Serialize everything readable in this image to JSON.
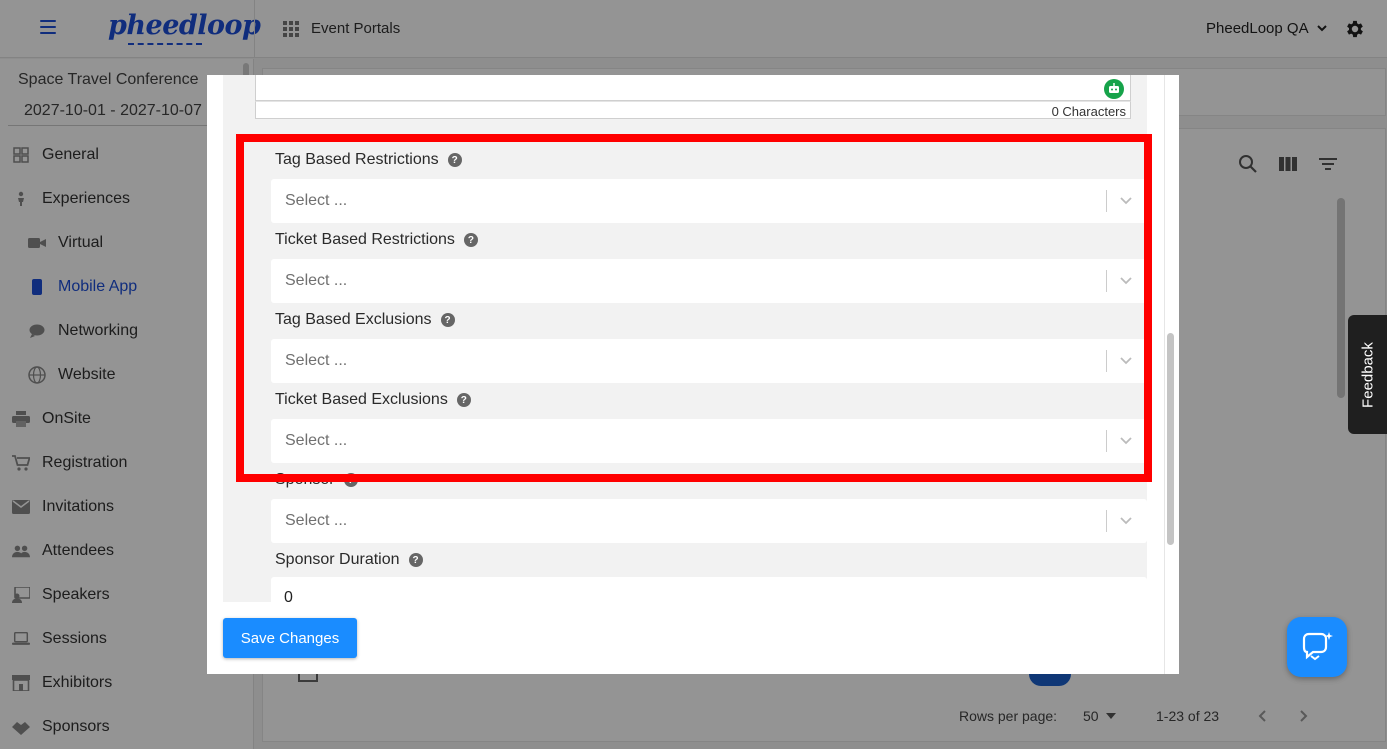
{
  "topbar": {
    "logo": "pheedloop",
    "portals_label": "Event Portals",
    "org_label": "PheedLoop QA"
  },
  "sidebar": {
    "conference_name": "Space Travel Conference",
    "conference_dates": "2027-10-01 - 2027-10-07",
    "items": [
      {
        "label": "General",
        "icon": "grid-icon"
      },
      {
        "label": "Experiences",
        "icon": "person-icon"
      },
      {
        "label": "Virtual",
        "icon": "video-camera-icon"
      },
      {
        "label": "Mobile App",
        "icon": "mobile-phone-icon"
      },
      {
        "label": "Networking",
        "icon": "chat-bubble-icon"
      },
      {
        "label": "Website",
        "icon": "globe-icon"
      },
      {
        "label": "OnSite",
        "icon": "printer-icon"
      },
      {
        "label": "Registration",
        "icon": "cart-icon"
      },
      {
        "label": "Invitations",
        "icon": "envelope-icon"
      },
      {
        "label": "Attendees",
        "icon": "people-icon"
      },
      {
        "label": "Speakers",
        "icon": "speaker-icon"
      },
      {
        "label": "Sessions",
        "icon": "laptop-icon"
      },
      {
        "label": "Exhibitors",
        "icon": "store-icon"
      },
      {
        "label": "Sponsors",
        "icon": "sponsor-icon"
      }
    ]
  },
  "table_footer": {
    "rows_per_page_label": "Rows per page:",
    "rows_per_page_value": "50",
    "range": "1-23 of 23"
  },
  "feedback": {
    "label": "Feedback"
  },
  "modal": {
    "char_count": "0 Characters",
    "fields": [
      {
        "label": "Tag Based Restrictions",
        "placeholder": "Select ..."
      },
      {
        "label": "Ticket Based Restrictions",
        "placeholder": "Select ..."
      },
      {
        "label": "Tag Based Exclusions",
        "placeholder": "Select ..."
      },
      {
        "label": "Ticket Based Exclusions",
        "placeholder": "Select ..."
      },
      {
        "label": "Sponsor",
        "placeholder": "Select ..."
      }
    ],
    "sponsor_duration": {
      "label": "Sponsor Duration",
      "value": "0"
    },
    "save_label": "Save Changes"
  },
  "colors": {
    "accent": "#1a8cff",
    "brand": "#1d4ed8",
    "highlight": "#ff0000",
    "assist_icon": "#16a34a"
  }
}
